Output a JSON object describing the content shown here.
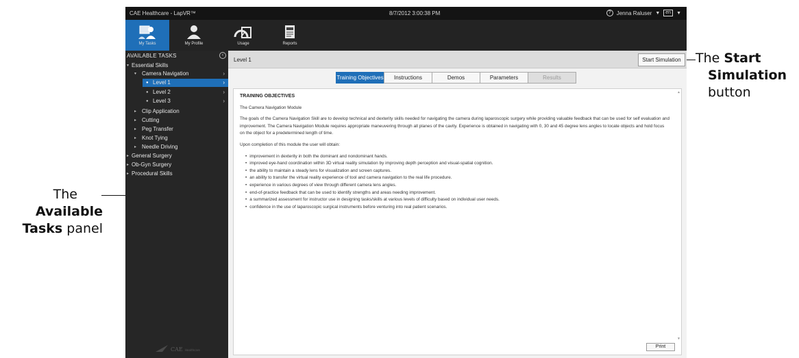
{
  "titlebar": {
    "title": "CAE Healthcare - LapVR™",
    "datetime": "8/7/2012 3:00:38 PM",
    "user": "Jenna Raluser",
    "lang": "en"
  },
  "toolbar": {
    "items": [
      {
        "label": "My Tasks",
        "icon": "my-tasks-icon"
      },
      {
        "label": "My Profile",
        "icon": "profile-icon"
      },
      {
        "label": "Usage",
        "icon": "usage-icon"
      },
      {
        "label": "Reports",
        "icon": "reports-icon"
      }
    ]
  },
  "sidebar": {
    "header": "AVAILABLE TASKS",
    "tree": [
      {
        "label": "Essential Skills"
      },
      {
        "label": "Camera Navigation"
      },
      {
        "label": "Level 1"
      },
      {
        "label": "Level 2"
      },
      {
        "label": "Level 3"
      },
      {
        "label": "Clip Application"
      },
      {
        "label": "Cutting"
      },
      {
        "label": "Peg Transfer"
      },
      {
        "label": "Knot Tying"
      },
      {
        "label": "Needle Driving"
      },
      {
        "label": "General Surgery"
      },
      {
        "label": "Ob-Gyn Surgery"
      },
      {
        "label": "Procedural Skills"
      }
    ],
    "logo_text": "CAE Healthcare"
  },
  "main": {
    "level_label": "Level 1",
    "start_button": "Start Simulation",
    "tabs": [
      {
        "label": "Training Objectives",
        "state": "active"
      },
      {
        "label": "Instructions",
        "state": "normal"
      },
      {
        "label": "Demos",
        "state": "normal"
      },
      {
        "label": "Parameters",
        "state": "normal"
      },
      {
        "label": "Results",
        "state": "disabled"
      }
    ],
    "doc": {
      "heading": "TRAINING OBJECTIVES",
      "module": "The Camera Navigation Module",
      "para1": "The goals of the Camera Navigation Skill are to develop technical and dexterity skills needed for navigating the camera during laparoscopic surgery while providing valuable feedback that can be used for self evaluation and improvement. The Camera Navigation Module requires appropriate maneuvering through all planes of the cavity. Experience is obtained in navigating with 0, 30 and 45 degree lens angles to locate objects and hold focus on the object for a predetermined length of time.",
      "para2": "Upon completion of this module the user will obtain:",
      "bullets": [
        "improvement in dexterity in both the dominant and nondominant hands.",
        "improved eye-hand coordination within 3D virtual reality simulation by improving depth perception and visual-spatial cognition.",
        "the ability to maintain a steady lens for visualization and screen captures.",
        "an ability to transfer the virtual reality experience of tool and camera navigation to the real life procedure.",
        "experience in various degrees of view through different camera lens angles.",
        "end-of-practice feedback that can be used to identify strengths and areas needing improvement.",
        "a summarized assessment for instructor use in designing tasks/skills at various levels of difficulty based on individual user needs.",
        "confidence in the use of laparoscopic surgical instruments before venturing into real patient scenarios."
      ]
    },
    "print_button": "Print"
  },
  "annotations": {
    "start": {
      "pre": "The ",
      "bold1": "Start",
      "bold2": "Simulation",
      "post": "button"
    },
    "panel": {
      "pre": "The",
      "bold1": "Available",
      "bold2": "Tasks",
      "post": " panel"
    }
  },
  "colors": {
    "accent": "#1f6fb8",
    "sidebar": "#262626",
    "content_bg": "#f2f2f2"
  }
}
